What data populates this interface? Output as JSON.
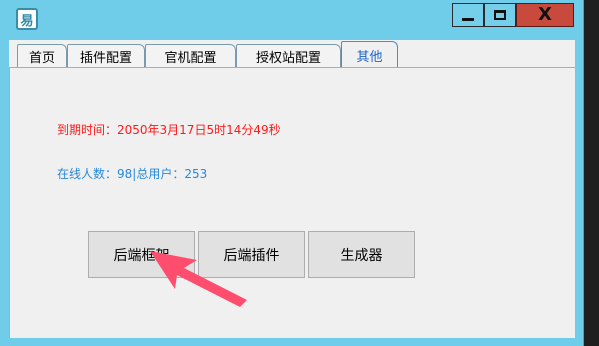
{
  "window": {
    "icon_glyph": "易",
    "minimize_label": "",
    "maximize_label": "",
    "close_label": "X"
  },
  "tabs": [
    {
      "label": "首页"
    },
    {
      "label": "插件配置"
    },
    {
      "label": "官机配置"
    },
    {
      "label": "授权站配置"
    },
    {
      "label": "其他",
      "active": true
    }
  ],
  "panel": {
    "expire_text": "到期时间：2050年3月17日5时14分49秒",
    "online_text": "在线人数：98|总用户：253",
    "buttons": [
      "后端框架",
      "后端插件",
      "生成器"
    ]
  },
  "colors": {
    "title_bar": "#6fcdea",
    "expire_text": "#ff1a1a",
    "online_text": "#2a88d8",
    "arrow": "#ff4d6d",
    "close_button": "#c84a3d"
  },
  "icons": [
    "app-icon",
    "minimize-icon",
    "maximize-icon",
    "close-icon",
    "arrow-annotation"
  ]
}
